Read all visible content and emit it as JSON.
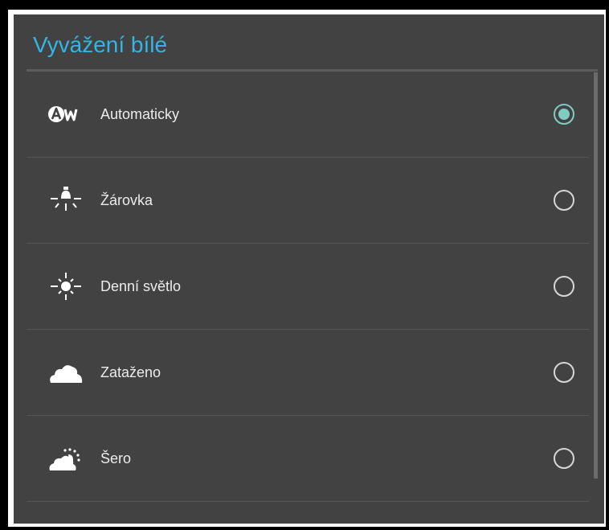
{
  "dialog": {
    "title": "Vyvážení bílé",
    "options": [
      {
        "label": "Automaticky",
        "icon": "auto-white-balance-icon",
        "selected": true
      },
      {
        "label": "Žárovka",
        "icon": "incandescent-bulb-icon",
        "selected": false
      },
      {
        "label": "Denní světlo",
        "icon": "sun-icon",
        "selected": false
      },
      {
        "label": "Zataženo",
        "icon": "cloud-icon",
        "selected": false
      },
      {
        "label": "Šero",
        "icon": "twilight-icon",
        "selected": false
      }
    ],
    "colors": {
      "accent": "#33b5e5",
      "radio_checked": "#80cbc4",
      "background": "#424242"
    }
  }
}
